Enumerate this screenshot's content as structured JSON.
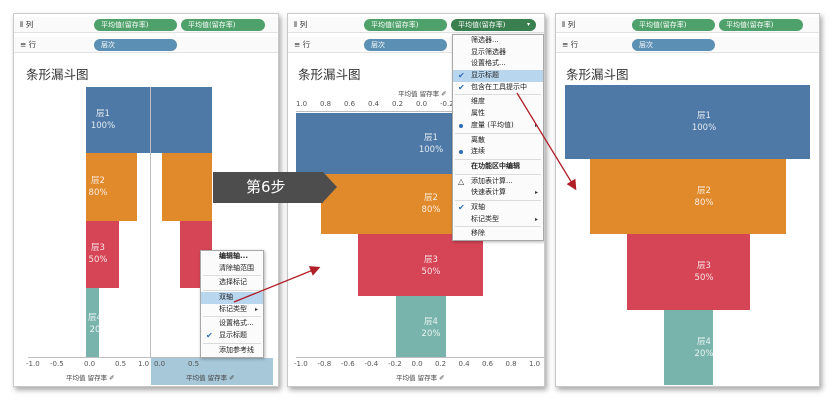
{
  "panels": {
    "p1": {
      "columns_label": "列",
      "rows_label": "行",
      "col_pill_1": "平均值(留存率)",
      "col_pill_2": "平均值(留存率)",
      "row_pill": "层次",
      "title": "条形漏斗图",
      "bars_left": [
        {
          "label": "层1",
          "value": "100%"
        },
        {
          "label": "层2",
          "value": "80%"
        },
        {
          "label": "层3",
          "value": "50%"
        },
        {
          "label": "层4",
          "value": "20"
        }
      ],
      "ticks_left": [
        "-1.0",
        "-0.5",
        "0.0",
        "0.5",
        "1.0"
      ],
      "ticks_right": [
        "0.0",
        "0.5"
      ],
      "axis_title_left": "平均值 留存率 ✐",
      "axis_title_right": "平均值 留存率 ✐",
      "menu": [
        "编辑轴...",
        "清除轴范围",
        "选择标记",
        "双轴",
        "标记类型",
        "设置格式...",
        "显示标题",
        "添加参考线"
      ]
    },
    "p2": {
      "columns_label": "列",
      "rows_label": "行",
      "col_pill_1": "平均值(留存率)",
      "col_pill_2": "平均值(留存率)",
      "row_pill": "层次",
      "title": "条形漏斗图",
      "axis_title_top": "平均值 留存率 ✐",
      "ticks_top": [
        "1.0",
        "0.8",
        "0.6",
        "0.4",
        "0.2",
        "0.0",
        "-0.2"
      ],
      "ticks_bottom": [
        "-1.0",
        "-0.8",
        "-0.6",
        "-0.4",
        "-0.2",
        "0.0",
        "0.2",
        "0.4",
        "0.6",
        "0.8",
        "1.0"
      ],
      "axis_title_bottom": "平均值 留存率 ✐",
      "bars": [
        {
          "label": "层1",
          "value": "100%"
        },
        {
          "label": "层2",
          "value": "80%"
        },
        {
          "label": "层3",
          "value": "50%"
        },
        {
          "label": "层4",
          "value": "20%"
        }
      ],
      "menu": [
        "筛选器...",
        "显示筛选器",
        "设置格式...",
        "显示标题",
        "包含在工具提示中",
        "维度",
        "属性",
        "度量 (平均值)",
        "离散",
        "连续",
        "在功能区中编辑",
        "添加表计算...",
        "快速表计算",
        "双轴",
        "标记类型",
        "移除"
      ]
    },
    "p3": {
      "columns_label": "列",
      "rows_label": "行",
      "col_pill_1": "平均值(留存率)",
      "col_pill_2": "平均值(留存率)",
      "row_pill": "层次",
      "title": "条形漏斗图",
      "bars": [
        {
          "label": "层1",
          "value": "100%"
        },
        {
          "label": "层2",
          "value": "80%"
        },
        {
          "label": "层3",
          "value": "50%"
        },
        {
          "label": "层4",
          "value": "20%"
        }
      ]
    }
  },
  "step_label": "第6步",
  "colors": {
    "layer1": "#4e79a7",
    "layer2": "#e08a2c",
    "layer3": "#d64556",
    "layer4": "#78b4ac",
    "pill_green": "#4fa16b",
    "pill_blue": "#5b8fb3",
    "arrow": "#b01e28"
  }
}
